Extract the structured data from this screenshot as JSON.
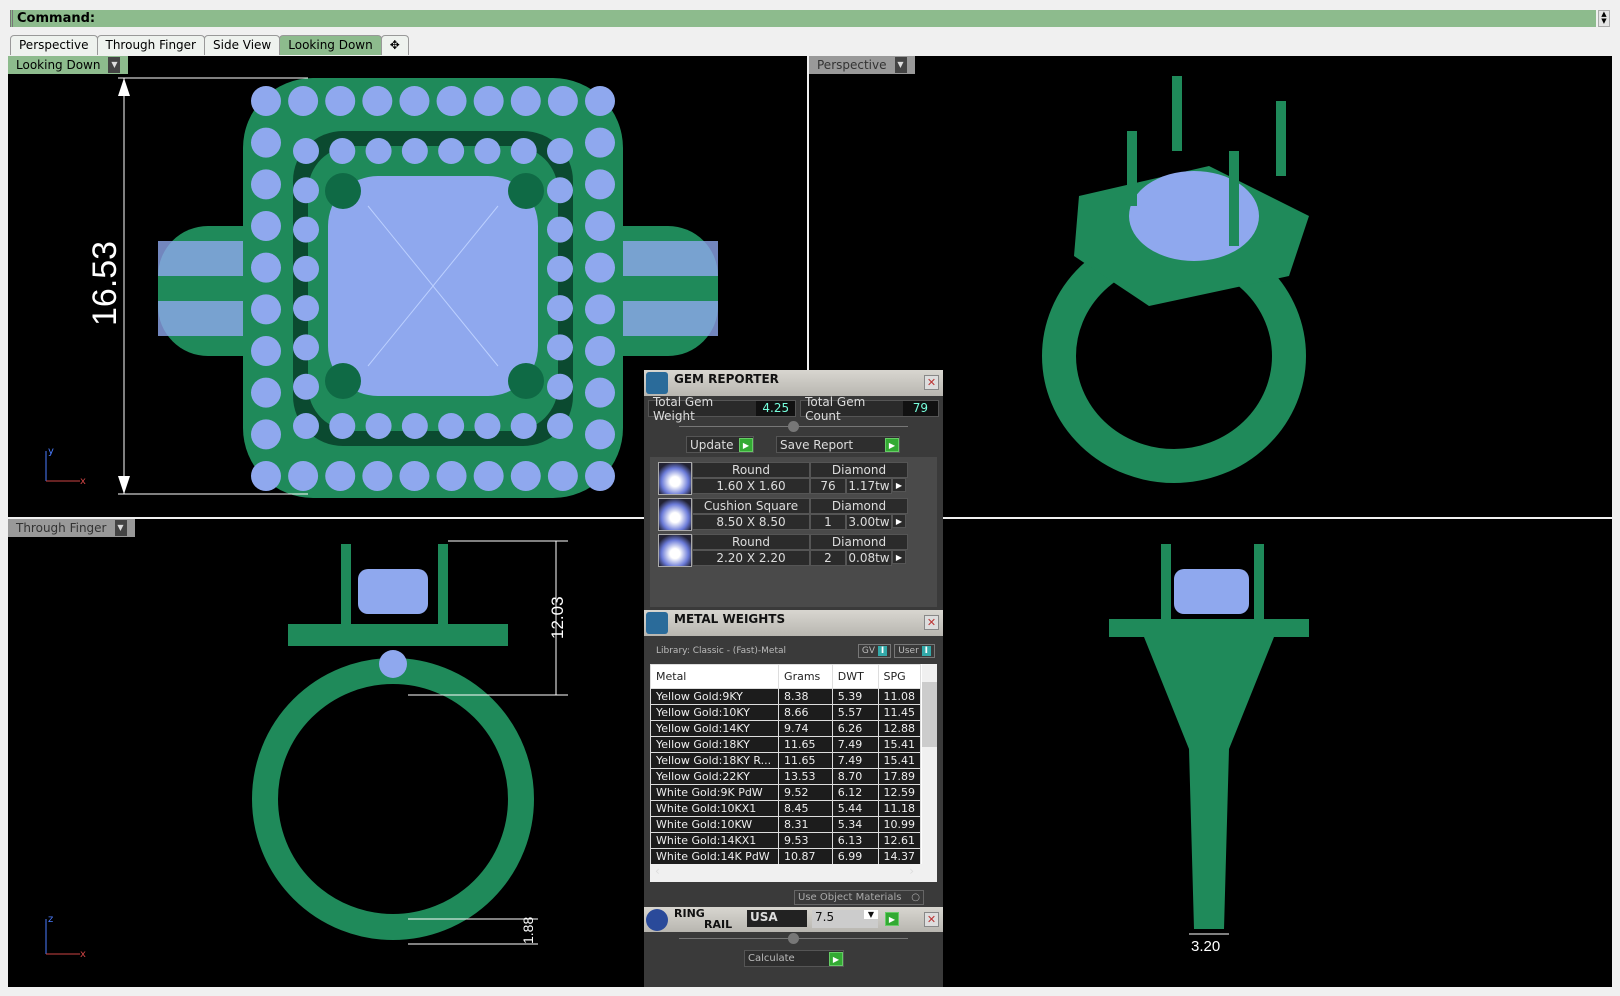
{
  "command": {
    "label": "Command:"
  },
  "tabs": [
    {
      "label": "Perspective"
    },
    {
      "label": "Through Finger"
    },
    {
      "label": "Side View"
    },
    {
      "label": "Looking Down",
      "active": true
    },
    {
      "label": "✥"
    }
  ],
  "viewports": {
    "top_left": {
      "label": "Looking Down",
      "dimension": "16.53",
      "axes": [
        "y",
        "x"
      ]
    },
    "top_right": {
      "label": "Perspective"
    },
    "bottom_left": {
      "label": "Through Finger",
      "dimensions": [
        "12.03",
        "1.88"
      ],
      "axes": [
        "z",
        "x"
      ]
    },
    "bottom_right": {
      "dimension": "3.20"
    }
  },
  "gem_reporter": {
    "title": "GEM REPORTER",
    "total_weight_label": "Total Gem Weight",
    "total_weight": "4.25",
    "total_count_label": "Total Gem Count",
    "total_count": "79",
    "update": "Update",
    "save_report": "Save Report",
    "gems": [
      {
        "shape": "Round",
        "size": "1.60 X 1.60",
        "type": "Diamond",
        "count": "76",
        "weight": "1.17tw"
      },
      {
        "shape": "Cushion Square",
        "size": "8.50 X 8.50",
        "type": "Diamond",
        "count": "1",
        "weight": "3.00tw"
      },
      {
        "shape": "Round",
        "size": "2.20 X 2.20",
        "type": "Diamond",
        "count": "2",
        "weight": "0.08tw"
      }
    ]
  },
  "metal_weights": {
    "title": "METAL WEIGHTS",
    "library": "Library: Classic - (Fast)-Metal",
    "gv": "GV",
    "user": "User",
    "columns": [
      "Metal",
      "Grams",
      "DWT",
      "SPG"
    ],
    "rows": [
      [
        "Yellow Gold:9KY",
        "8.38",
        "5.39",
        "11.08"
      ],
      [
        "Yellow Gold:10KY",
        "8.66",
        "5.57",
        "11.45"
      ],
      [
        "Yellow Gold:14KY",
        "9.74",
        "6.26",
        "12.88"
      ],
      [
        "Yellow Gold:18KY",
        "11.65",
        "7.49",
        "15.41"
      ],
      [
        "Yellow Gold:18KY R...",
        "11.65",
        "7.49",
        "15.41"
      ],
      [
        "Yellow Gold:22KY",
        "13.53",
        "8.70",
        "17.89"
      ],
      [
        "White Gold:9K PdW",
        "9.52",
        "6.12",
        "12.59"
      ],
      [
        "White Gold:10KX1",
        "8.45",
        "5.44",
        "11.18"
      ],
      [
        "White Gold:10KW",
        "8.31",
        "5.34",
        "10.99"
      ],
      [
        "White Gold:14KX1",
        "9.53",
        "6.13",
        "12.61"
      ],
      [
        "White Gold:14K PdW",
        "10.87",
        "6.99",
        "14.37"
      ]
    ],
    "use_object_materials": "Use Object Materials"
  },
  "ring_rail": {
    "title_1": "RING",
    "title_2": "RAIL",
    "standard": "USA",
    "size": "7.5",
    "calculate": "Calculate"
  },
  "colors": {
    "metal": "#1f8a5a",
    "gem": "#8fa8ee",
    "accent": "#8dbb8d"
  }
}
